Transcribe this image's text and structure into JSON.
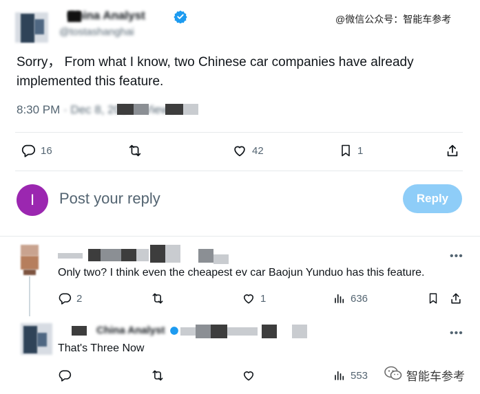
{
  "watermark_top": "@微信公众号：智能车参考",
  "main_tweet": {
    "author_name": "China Analyst",
    "author_handle": "@tostashanghai",
    "verified_icon": "verified-badge-icon",
    "text": "Sorry，  From what I know, two Chinese car companies have already implemented this feature.",
    "time": "8:30 PM",
    "date_views": "· Dec 8, 2024 · Views",
    "actions": {
      "reply_count": "16",
      "repost_count": "",
      "like_count": "42",
      "bookmark_count": "1"
    }
  },
  "reply_composer": {
    "avatar_letter": "I",
    "placeholder": "Post your reply",
    "button_label": "Reply"
  },
  "replies": [
    {
      "text": "Only two? I think even the cheapest ev car Baojun Yunduo has this feature.",
      "reply_count": "2",
      "like_count": "1",
      "views": "636"
    },
    {
      "author_name": "China Analyst",
      "text": "That's Three Now",
      "views": "553"
    }
  ],
  "watermark_bottom": "智能车参考",
  "colors": {
    "accent": "#1d9bf0",
    "reply_button": "#8ecdf8",
    "avatar_purple": "#9b27b0",
    "muted": "#536471"
  }
}
